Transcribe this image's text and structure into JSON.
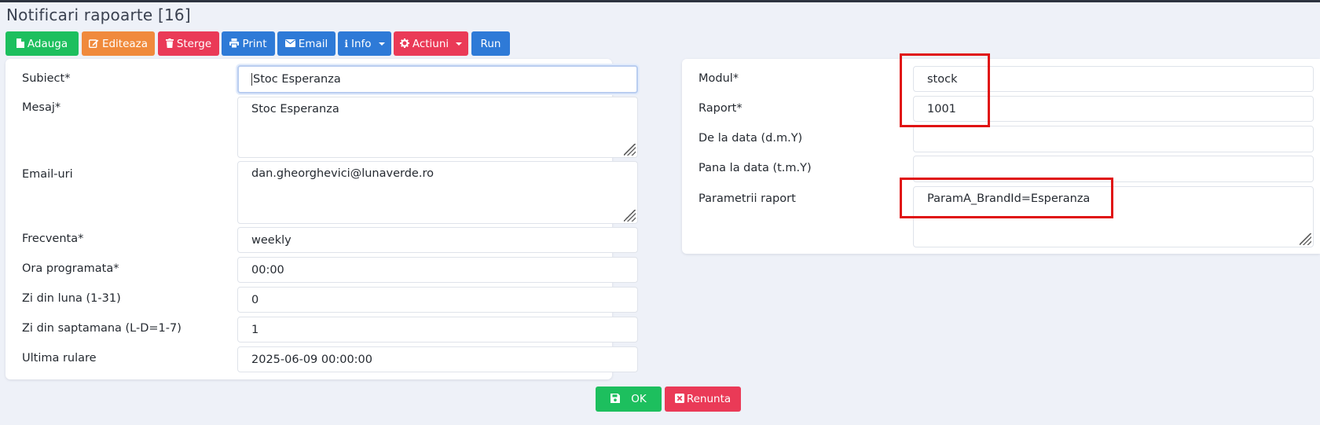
{
  "page": {
    "title": "Notificari rapoarte [16]"
  },
  "toolbar": {
    "add": "Adauga",
    "edit": "Editeaza",
    "delete": "Sterge",
    "print": "Print",
    "email": "Email",
    "info": "Info",
    "actions": "Actiuni",
    "run": "Run"
  },
  "left_form": {
    "subject": {
      "label": "Subiect*",
      "value": "Stoc Esperanza"
    },
    "message": {
      "label": "Mesaj*",
      "value": "Stoc Esperanza"
    },
    "emails": {
      "label": "Email-uri",
      "value": "dan.gheorghevici@lunaverde.ro"
    },
    "frequency": {
      "label": "Frecventa*",
      "value": "weekly"
    },
    "scheduled_hour": {
      "label": "Ora programata*",
      "value": "00:00"
    },
    "day_of_month": {
      "label": "Zi din luna (1-31)",
      "value": "0"
    },
    "day_of_week": {
      "label": "Zi din saptamana (L-D=1-7)",
      "value": "1"
    },
    "last_run": {
      "label": "Ultima rulare",
      "value": "2025-06-09 00:00:00"
    }
  },
  "right_form": {
    "module": {
      "label": "Modul*",
      "value": "stock"
    },
    "report": {
      "label": "Raport*",
      "value": "1001"
    },
    "date_from": {
      "label": "De la data (d.m.Y)",
      "value": ""
    },
    "date_to": {
      "label": "Pana la data (t.m.Y)",
      "value": ""
    },
    "params": {
      "label": "Parametrii raport",
      "value": "ParamA_BrandId=Esperanza"
    }
  },
  "footer": {
    "ok": "OK",
    "cancel": "Renunta"
  },
  "icons": {
    "add": "file-icon",
    "edit": "edit-icon",
    "delete": "trash-icon",
    "print": "print-icon",
    "email": "envelope-icon",
    "info": "info-icon",
    "actions": "gear-icon",
    "ok": "save-icon",
    "cancel": "close-box-icon"
  },
  "colors": {
    "green": "#1dbf5e",
    "orange": "#f08a3c",
    "red": "#ea3a57",
    "blue": "#2e7ad7",
    "highlight": "#e01212",
    "background": "#eef1f8"
  }
}
